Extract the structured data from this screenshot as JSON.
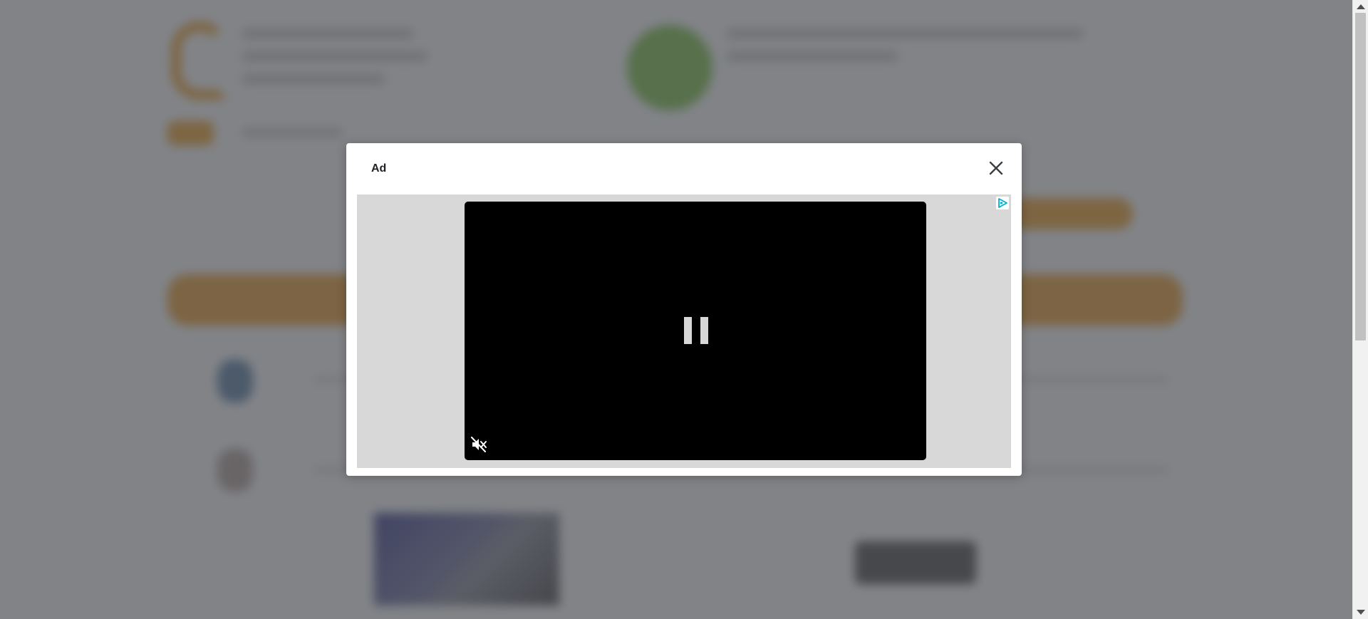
{
  "modal": {
    "title": "Ad",
    "close_icon": "close-icon",
    "adchoices_icon": "adchoices-icon"
  },
  "video": {
    "state_icon": "pause-icon",
    "volume_icon": "muted-speaker-icon"
  },
  "colors": {
    "overlay": "#46484e",
    "modal_background": "#ffffff",
    "ad_area_background": "#d8d8d8",
    "video_background": "#000000",
    "adchoices_accent": "#00aecd",
    "background_brand_orange": "#f0a02f",
    "background_badge_green": "#7fc447"
  }
}
